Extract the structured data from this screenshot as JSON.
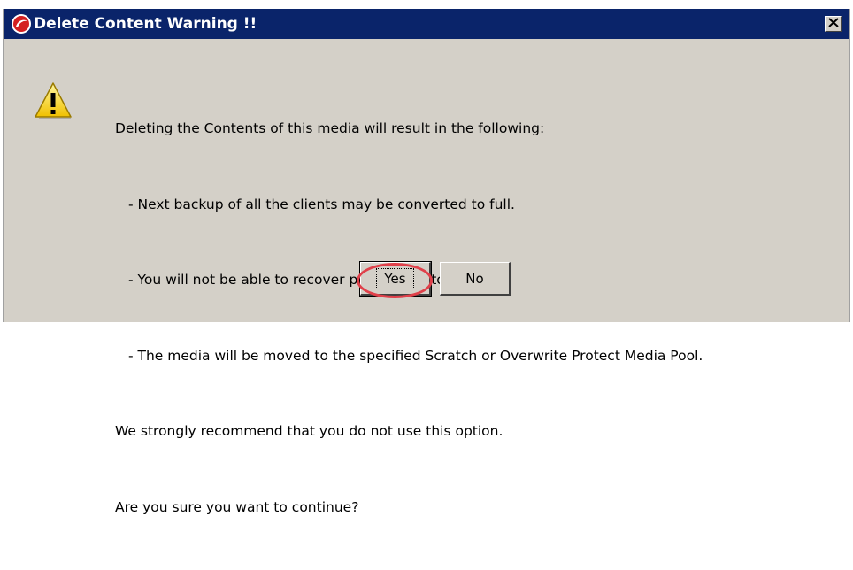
{
  "dialog": {
    "title": "Delete Content Warning !!",
    "icons": {
      "app": "app-logo-icon",
      "warning": "warning-icon",
      "close": "close-icon"
    },
    "message": {
      "line1": "Deleting the Contents of this media will result in the following:",
      "bullet1": "- Next backup of all the clients may be converted to full.",
      "bullet2": "- You will not be able to recover previously stored data.",
      "bullet3": "- The media will be moved to the specified Scratch or Overwrite Protect Media Pool.",
      "line2": "We strongly recommend that you do not use this option.",
      "line3": "Are you sure you want to continue?"
    },
    "buttons": {
      "yes": "Yes",
      "no": "No"
    },
    "colors": {
      "titlebar": "#0a246a",
      "dialog_bg": "#d4d0c8",
      "highlight": "#e0404a"
    }
  }
}
